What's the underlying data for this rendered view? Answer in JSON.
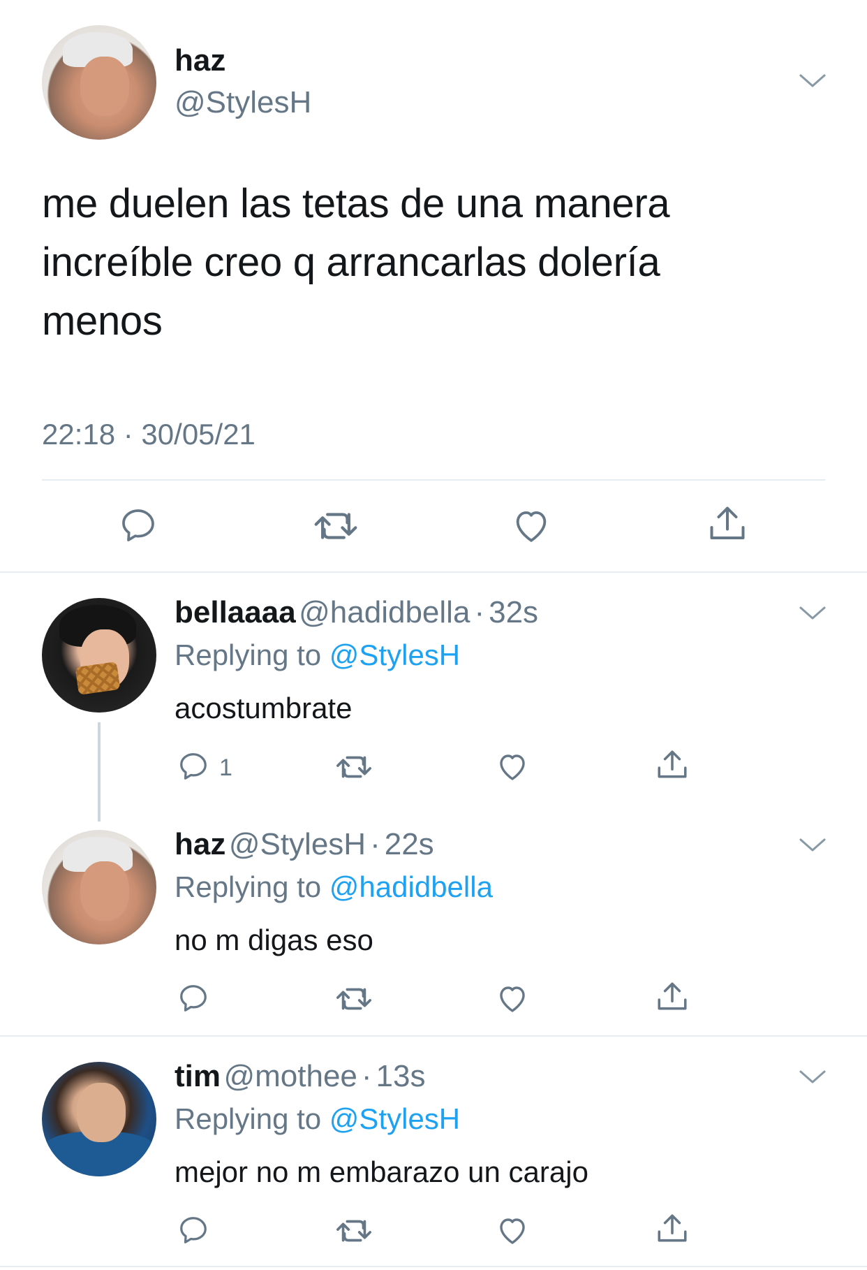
{
  "main_tweet": {
    "name": "haz",
    "handle": "@StylesH",
    "text_lines": [
      "me duelen las tetas de una manera",
      "increíble creo q arrancarlas dolería",
      "menos"
    ],
    "timestamp": "22:18 · 30/05/21",
    "icons": [
      "reply-icon",
      "retweet-icon",
      "like-icon",
      "share-icon"
    ]
  },
  "replies": [
    {
      "name": "bellaaaa",
      "handle": "@hadidbella",
      "time": "32s",
      "replying_label": "Replying to",
      "replying_to": "@StylesH",
      "text": "acostumbrate",
      "reply_count": "1"
    },
    {
      "name": "haz",
      "handle": "@StylesH",
      "time": "22s",
      "replying_label": "Replying to",
      "replying_to": "@hadidbella",
      "text": "no m digas eso",
      "reply_count": ""
    },
    {
      "name": "tim",
      "handle": "@mothee",
      "time": "13s",
      "replying_label": "Replying to",
      "replying_to": "@StylesH",
      "text": "mejor no m embarazo un carajo",
      "reply_count": ""
    }
  ],
  "separator": "·",
  "colors": {
    "text": "#14171a",
    "secondary": "#657786",
    "accent": "#1da1f2",
    "divider": "#e6ecf0"
  }
}
